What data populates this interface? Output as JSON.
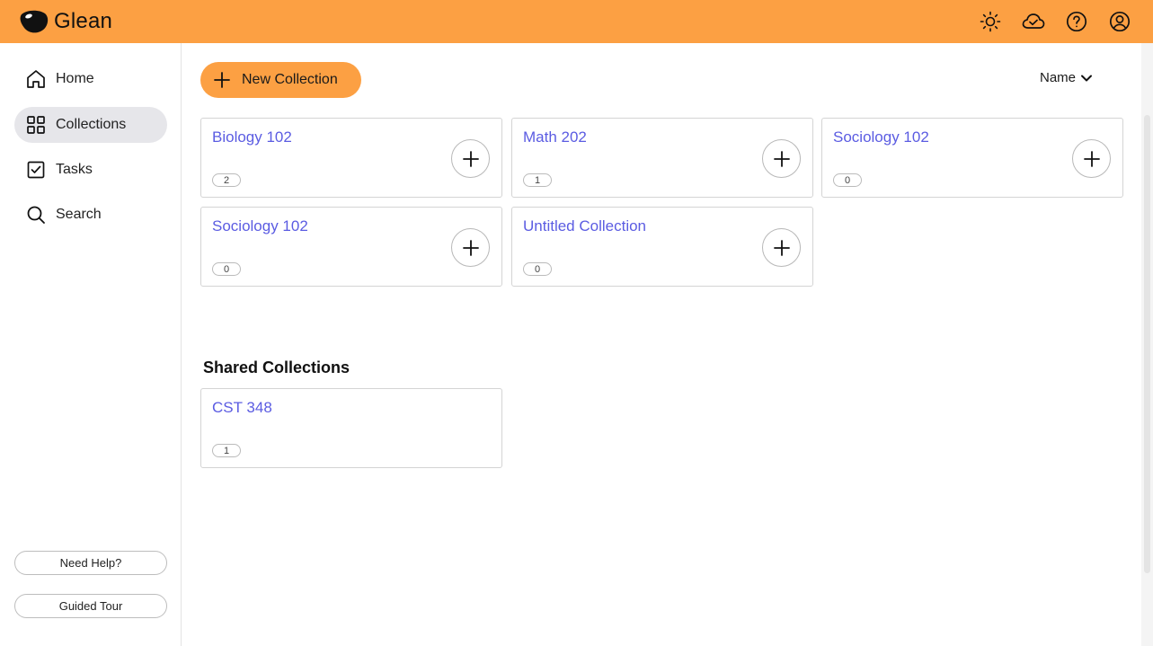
{
  "app": {
    "name": "Glean",
    "accent_color": "#fca043",
    "link_color": "#5b5ce2"
  },
  "topbar": {
    "icons": [
      "sun-icon",
      "cloud-check-icon",
      "help-icon",
      "account-icon"
    ]
  },
  "sidebar": {
    "items": [
      {
        "label": "Home",
        "icon": "home-icon",
        "active": false
      },
      {
        "label": "Collections",
        "icon": "grid-icon",
        "active": true
      },
      {
        "label": "Tasks",
        "icon": "checkbox-icon",
        "active": false
      },
      {
        "label": "Search",
        "icon": "search-icon",
        "active": false
      }
    ],
    "help_button": "Need Help?",
    "tour_button": "Guided Tour"
  },
  "main": {
    "new_collection_label": "New Collection",
    "sort_label": "Name",
    "collections": [
      {
        "title": "Biology 102",
        "count": "2"
      },
      {
        "title": "Math 202",
        "count": "1"
      },
      {
        "title": "Sociology 102",
        "count": "0"
      },
      {
        "title": "Sociology 102",
        "count": "0"
      },
      {
        "title": "Untitled Collection",
        "count": "0"
      }
    ],
    "shared_title": "Shared Collections",
    "shared_collections": [
      {
        "title": "CST 348",
        "count": "1"
      }
    ]
  }
}
